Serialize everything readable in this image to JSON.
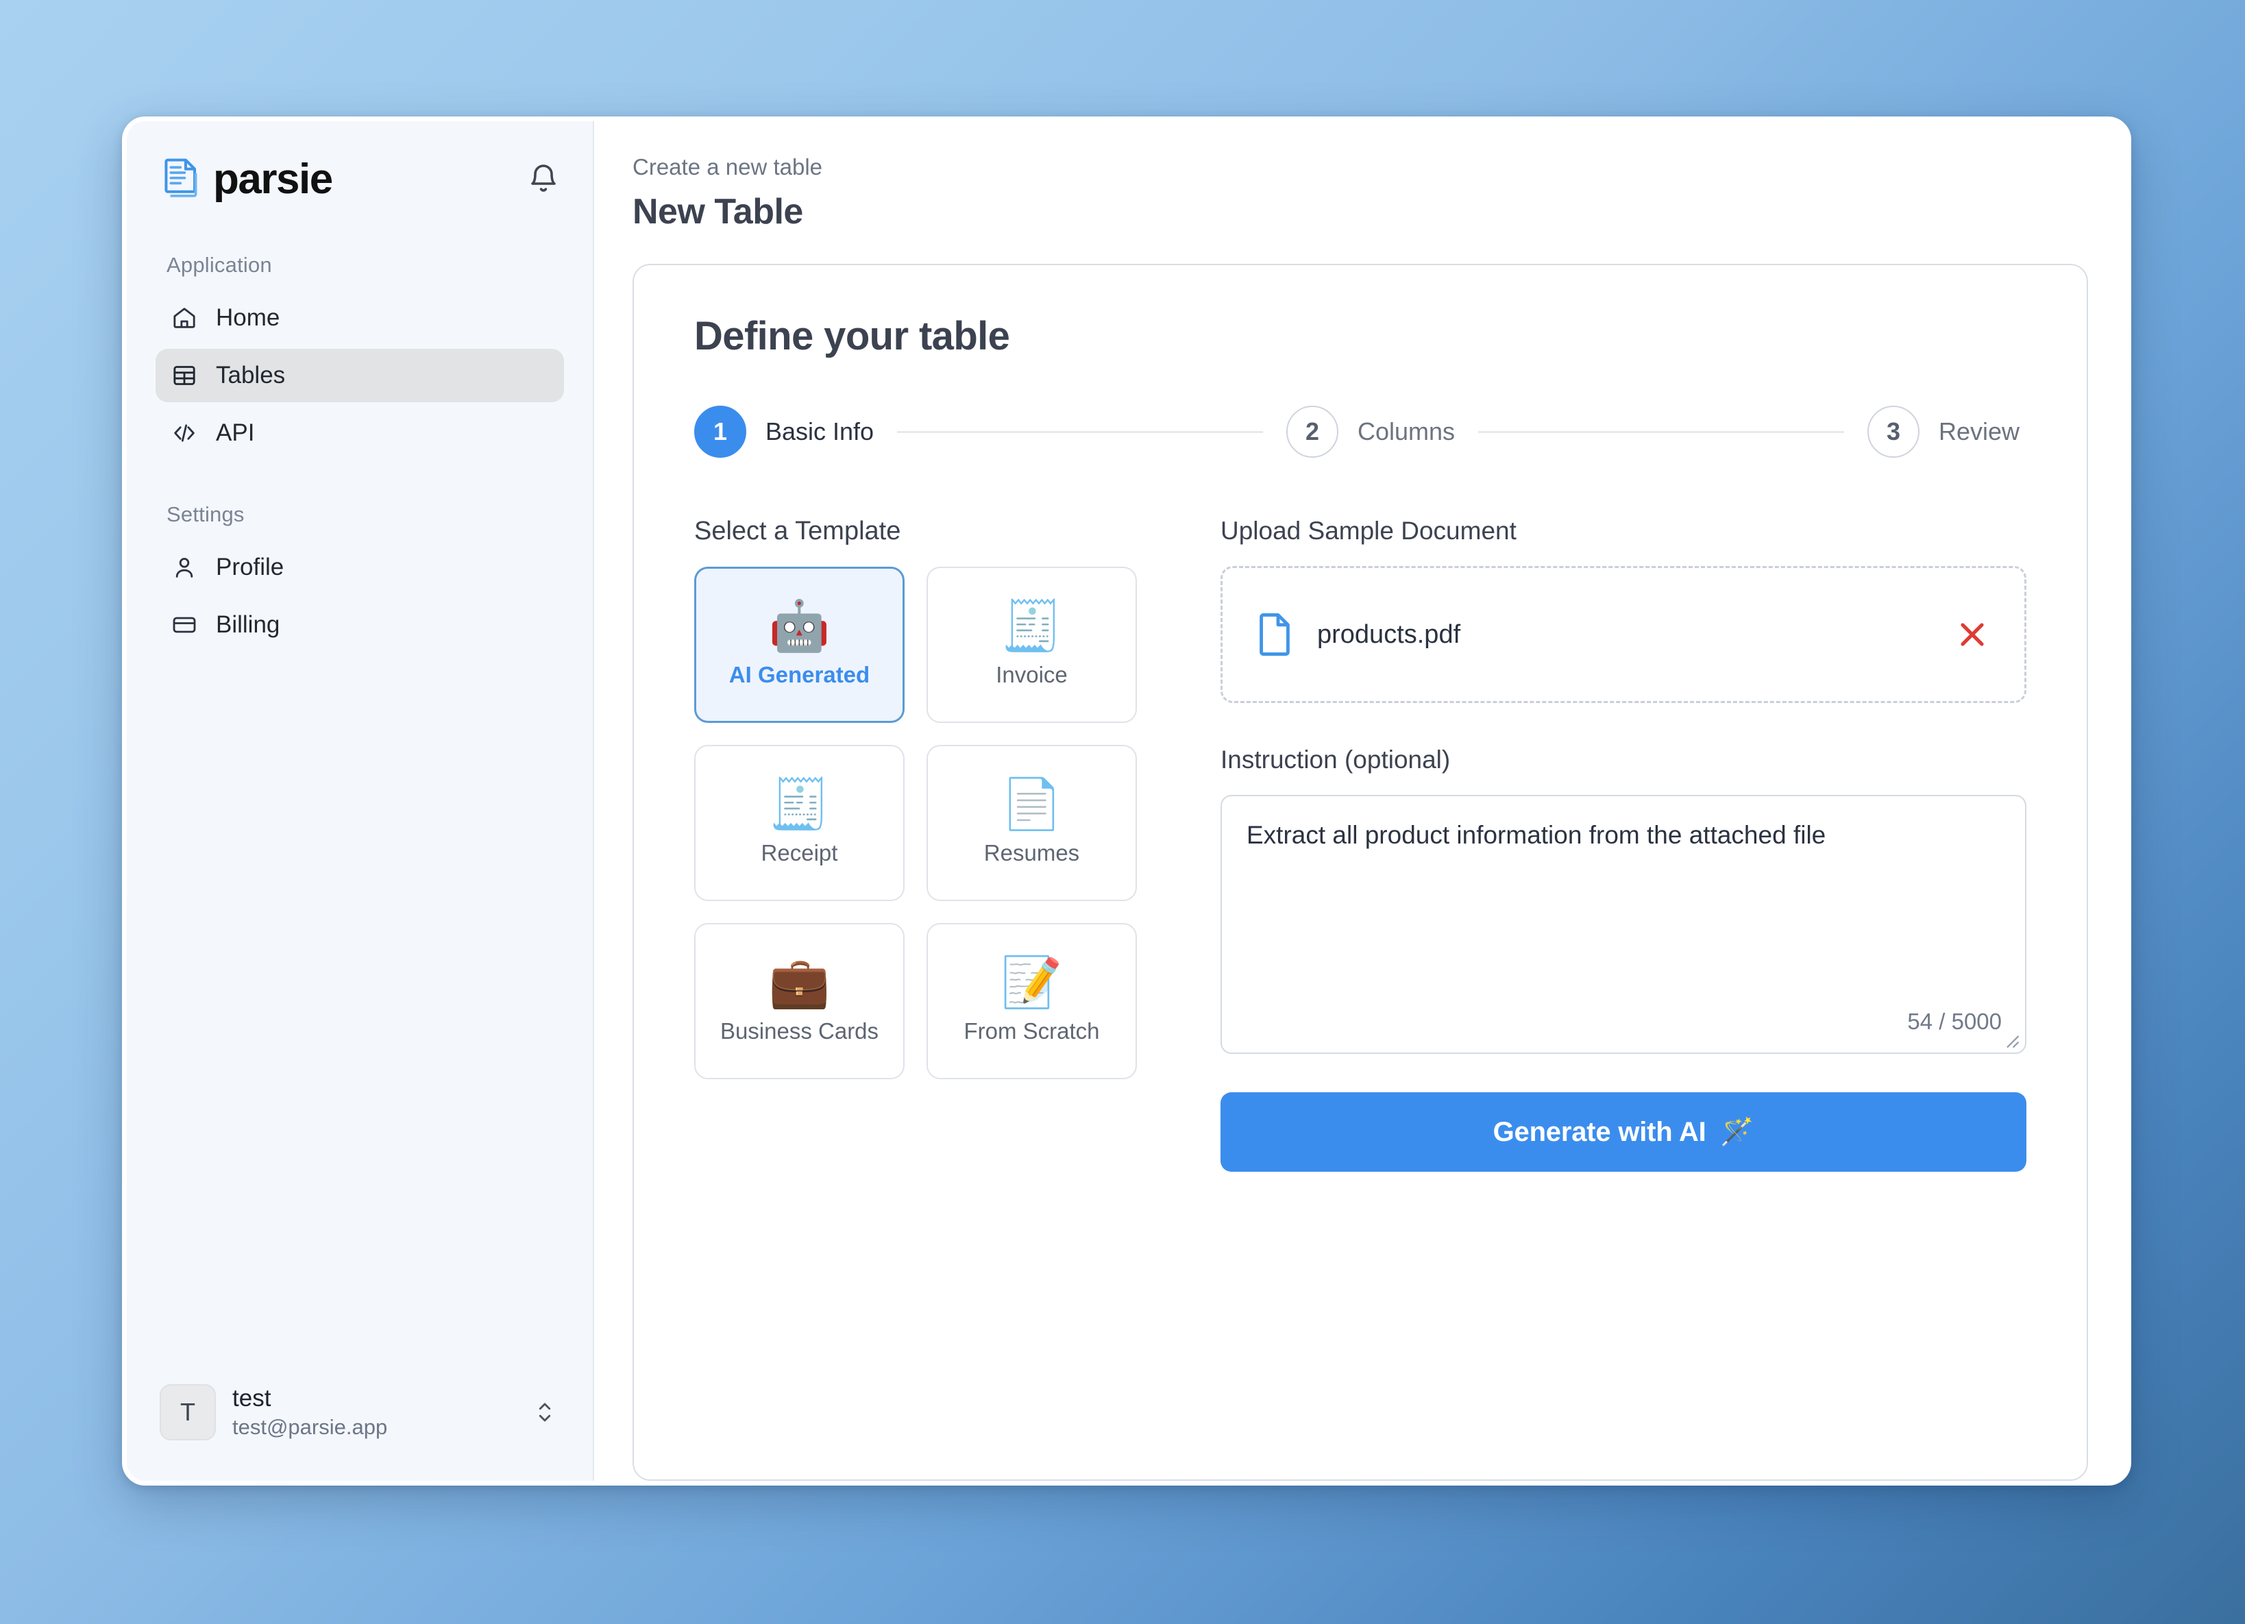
{
  "brand": {
    "name": "parsie",
    "logo_icon": "document-stack-icon",
    "bell_icon": "bell-icon"
  },
  "sidebar": {
    "sections": [
      {
        "label": "Application",
        "items": [
          {
            "label": "Home",
            "icon": "home-icon",
            "active": false
          },
          {
            "label": "Tables",
            "icon": "table-grid-icon",
            "active": true
          },
          {
            "label": "API",
            "icon": "code-brackets-icon",
            "active": false
          }
        ]
      },
      {
        "label": "Settings",
        "items": [
          {
            "label": "Profile",
            "icon": "user-icon",
            "active": false
          },
          {
            "label": "Billing",
            "icon": "credit-card-icon",
            "active": false
          }
        ]
      }
    ],
    "user": {
      "avatar_initial": "T",
      "name": "test",
      "email": "test@parsie.app",
      "switch_icon": "chevron-up-down-icon"
    }
  },
  "main": {
    "breadcrumb": "Create a new table",
    "page_title": "New Table",
    "card_title": "Define your table",
    "stepper": [
      {
        "number": "1",
        "label": "Basic Info",
        "active": true
      },
      {
        "number": "2",
        "label": "Columns",
        "active": false
      },
      {
        "number": "3",
        "label": "Review",
        "active": false
      }
    ],
    "templates": {
      "label": "Select a Template",
      "items": [
        {
          "label": "AI Generated",
          "emoji": "🤖",
          "icon": "robot-icon",
          "selected": true
        },
        {
          "label": "Invoice",
          "emoji": "🧾",
          "icon": "receipt-icon",
          "selected": false
        },
        {
          "label": "Receipt",
          "emoji": "🧾",
          "icon": "receipt-icon",
          "selected": false
        },
        {
          "label": "Resumes",
          "emoji": "📄",
          "icon": "page-curl-icon",
          "selected": false
        },
        {
          "label": "Business Cards",
          "emoji": "💼",
          "icon": "briefcase-icon",
          "selected": false
        },
        {
          "label": "From Scratch",
          "emoji": "📝",
          "icon": "memo-pencil-icon",
          "selected": false
        }
      ]
    },
    "upload": {
      "label": "Upload Sample Document",
      "file_name": "products.pdf",
      "file_icon": "file-document-icon",
      "remove_icon": "close-x-icon"
    },
    "instruction": {
      "label": "Instruction (optional)",
      "value": "Extract all product information from the attached file",
      "placeholder": "Instruction (optional)",
      "char_count": "54 / 5000"
    },
    "generate_button": {
      "label": "Generate with AI",
      "emoji": "🪄"
    }
  },
  "colors": {
    "accent_blue": "#3b8ded",
    "selected_card_border": "#5b9bd5",
    "selected_card_bg": "#eef4fd",
    "sidebar_bg": "#f4f7fc",
    "active_nav_bg": "#e2e3e5",
    "remove_red": "#e03b34"
  }
}
